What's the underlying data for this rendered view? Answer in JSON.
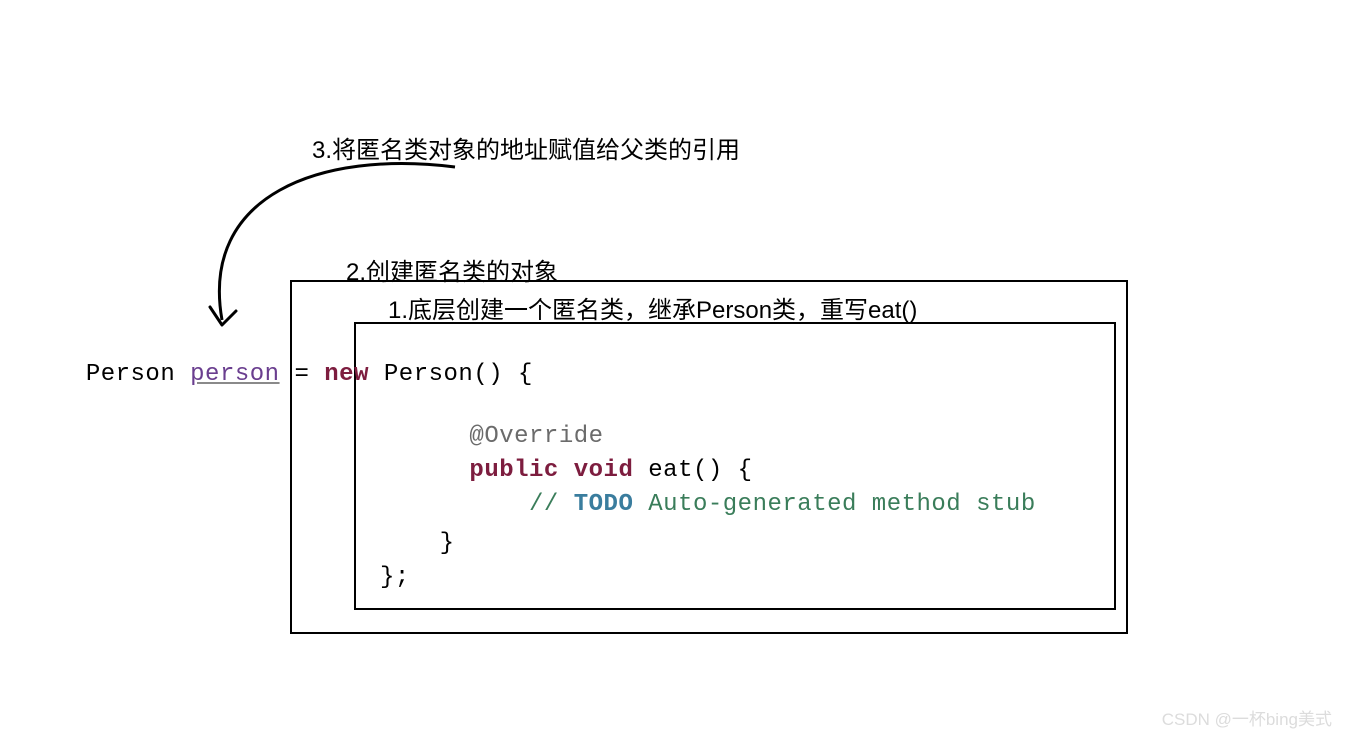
{
  "annotations": {
    "step3": "3.将匿名类对象的地址赋值给父类的引用",
    "step2": "2.创建匿名类的对象",
    "step1": "1.底层创建一个匿名类，继承Person类，重写eat()"
  },
  "code": {
    "classType": "Person ",
    "varName": "person",
    "assign": " = ",
    "newKw": "new",
    "afterNew": " Person() {",
    "overrideAnno": "    @Override",
    "pubKw": "    public",
    "voidKw": " void",
    "methodSig": " eat() {",
    "commentSlashes": "        // ",
    "todo": "TODO",
    "commentRest": " Auto-generated method stub",
    "closeInner": "    }",
    "closeOuter": "};"
  },
  "watermark": "CSDN @一杯bing美式"
}
